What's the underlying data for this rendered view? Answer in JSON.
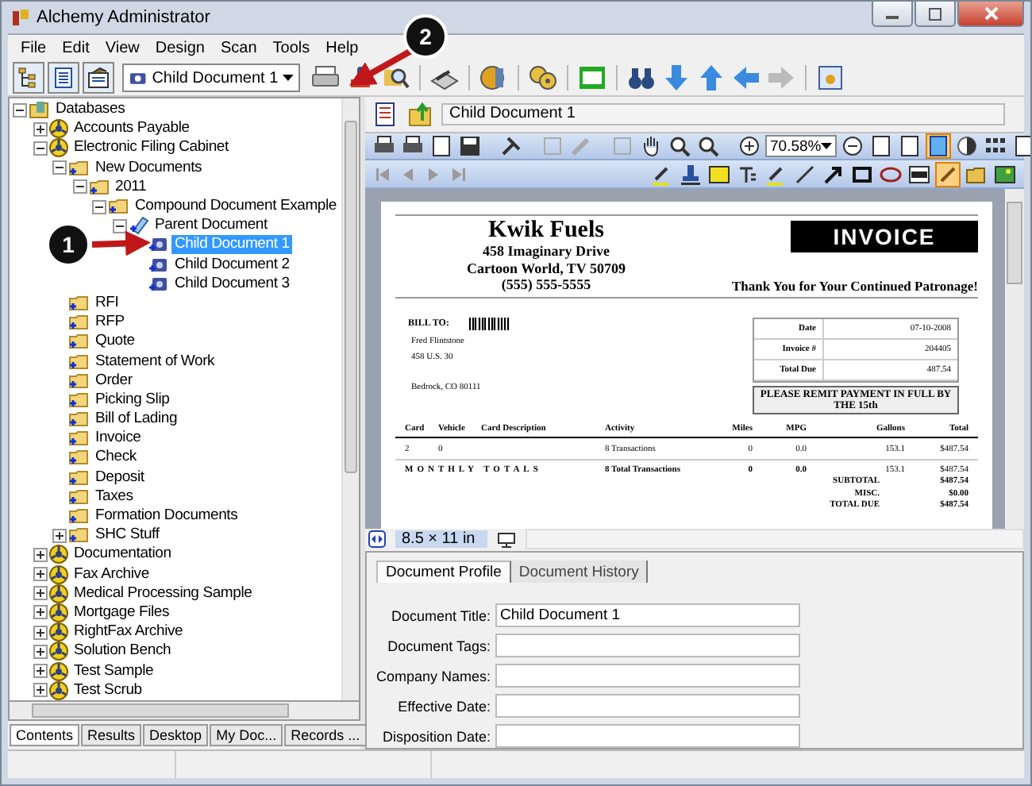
{
  "window": {
    "title": "Alchemy Administrator"
  },
  "menu": [
    "File",
    "Edit",
    "View",
    "Design",
    "Scan",
    "Tools",
    "Help"
  ],
  "toolbar": {
    "document_select": "Child Document 1"
  },
  "callouts": [
    {
      "number": "1"
    },
    {
      "number": "2"
    }
  ],
  "tree": [
    {
      "label": "Databases",
      "kind": "root",
      "expanded": true,
      "selected": false,
      "children": [
        {
          "label": "Accounts Payable",
          "kind": "database",
          "expanded": false,
          "selected": false
        },
        {
          "label": "Electronic Filing Cabinet",
          "kind": "database",
          "expanded": true,
          "selected": false,
          "children": [
            {
              "label": "New Documents",
              "kind": "folder",
              "expanded": true,
              "selected": false,
              "children": [
                {
                  "label": "2011",
                  "kind": "folder",
                  "expanded": true,
                  "selected": false,
                  "children": [
                    {
                      "label": "Compound Document Example",
                      "kind": "folder",
                      "expanded": true,
                      "selected": false,
                      "children": [
                        {
                          "label": "Parent Document",
                          "kind": "parent",
                          "expanded": true,
                          "selected": false,
                          "children": [
                            {
                              "label": "Child Document 1",
                              "kind": "child",
                              "selected": true
                            },
                            {
                              "label": "Child Document 2",
                              "kind": "child",
                              "selected": false
                            },
                            {
                              "label": "Child Document 3",
                              "kind": "child",
                              "selected": false
                            }
                          ]
                        }
                      ]
                    }
                  ]
                }
              ]
            },
            {
              "label": "RFI",
              "kind": "folder",
              "selected": false
            },
            {
              "label": "RFP",
              "kind": "folder",
              "selected": false
            },
            {
              "label": "Quote",
              "kind": "folder",
              "selected": false
            },
            {
              "label": "Statement of Work",
              "kind": "folder",
              "selected": false
            },
            {
              "label": "Order",
              "kind": "folder",
              "selected": false
            },
            {
              "label": "Picking Slip",
              "kind": "folder",
              "selected": false
            },
            {
              "label": "Bill of Lading",
              "kind": "folder",
              "selected": false
            },
            {
              "label": "Invoice",
              "kind": "folder",
              "selected": false
            },
            {
              "label": "Check",
              "kind": "folder",
              "selected": false
            },
            {
              "label": "Deposit",
              "kind": "folder",
              "selected": false
            },
            {
              "label": "Taxes",
              "kind": "folder",
              "selected": false
            },
            {
              "label": "Formation Documents",
              "kind": "folder",
              "selected": false
            },
            {
              "label": "SHC Stuff",
              "kind": "folder",
              "expanded": false,
              "selected": false
            }
          ]
        },
        {
          "label": "Documentation",
          "kind": "database",
          "expanded": false,
          "selected": false
        },
        {
          "label": "Fax Archive",
          "kind": "database",
          "expanded": false,
          "selected": false
        },
        {
          "label": "Medical Processing Sample",
          "kind": "database",
          "expanded": false,
          "selected": false
        },
        {
          "label": "Mortgage Files",
          "kind": "database",
          "expanded": false,
          "selected": false
        },
        {
          "label": "RightFax Archive",
          "kind": "database",
          "expanded": false,
          "selected": false
        },
        {
          "label": "Solution Bench",
          "kind": "database",
          "expanded": false,
          "selected": false
        },
        {
          "label": "Test Sample",
          "kind": "database",
          "expanded": false,
          "selected": false
        },
        {
          "label": "Test Scrub",
          "kind": "database",
          "expanded": false,
          "selected": false
        }
      ]
    }
  ],
  "left_tabs": [
    {
      "label": "Contents",
      "selected": true
    },
    {
      "label": "Results",
      "selected": false
    },
    {
      "label": "Desktop",
      "selected": false
    },
    {
      "label": "My Doc...",
      "selected": false
    },
    {
      "label": "Records ...",
      "selected": false
    }
  ],
  "address": {
    "value": "Child Document 1"
  },
  "viewer": {
    "zoom": "70.58%",
    "page_size": "8.5 × 11 in"
  },
  "invoice": {
    "company": "Kwik Fuels",
    "address": [
      "458 Imaginary Drive",
      "Cartoon World, TV 50709",
      "(555) 555-5555"
    ],
    "title": "INVOICE",
    "thanks": "Thank You for Your Continued Patronage!",
    "bill_to_label": "BILL TO:",
    "customer": [
      "Fred Flintstone",
      "458 U.S. 30"
    ],
    "customer_city": "Bedrock, CO 80111",
    "info": [
      {
        "label": "Date",
        "value": "07-10-2008"
      },
      {
        "label": "Invoice #",
        "value": "204405"
      },
      {
        "label": "Total Due",
        "value": "487.54"
      }
    ],
    "notice": "PLEASE REMIT PAYMENT IN FULL BY THE 15th",
    "columns": [
      "Card",
      "Vehicle",
      "Card Description",
      "Activity",
      "Miles",
      "MPG",
      "Gallons",
      "Total"
    ],
    "rows": [
      {
        "card": "2",
        "vehicle": "0",
        "activity": "8 Transactions",
        "miles": "0",
        "mpg": "0.0",
        "gallons": "153.1",
        "total": "$487.54"
      }
    ],
    "monthly": {
      "label": "MONTHLY TOTALS",
      "activity": "8 Total Transactions",
      "miles": "0",
      "mpg": "0.0",
      "gallons": "153.1",
      "total": "$487.54"
    },
    "summary": [
      {
        "label": "SUBTOTAL",
        "value": "$487.54"
      },
      {
        "label": "MISC.",
        "value": "$0.00"
      },
      {
        "label": "TOTAL DUE",
        "value": "$487.54"
      }
    ]
  },
  "profile_tabs": [
    {
      "label": "Document Profile",
      "selected": true
    },
    {
      "label": "Document History",
      "selected": false
    }
  ],
  "profile_fields": [
    {
      "label": "Document Title:",
      "value": "Child Document 1"
    },
    {
      "label": "Document Tags:"
    },
    {
      "label": "Company Names:"
    },
    {
      "label": "Effective Date:"
    },
    {
      "label": "Disposition Date:"
    }
  ]
}
